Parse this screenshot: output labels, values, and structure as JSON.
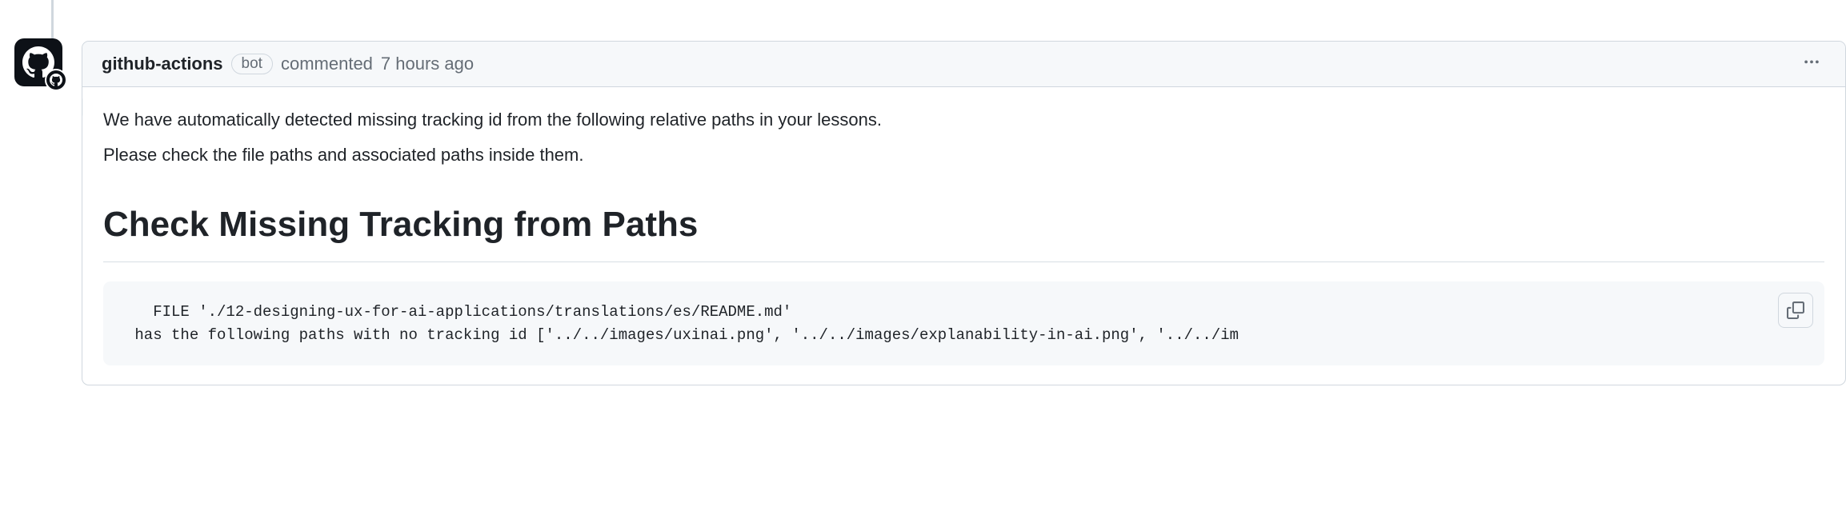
{
  "comment": {
    "author": "github-actions",
    "bot_label": "bot",
    "action_text": "commented",
    "timestamp": "7 hours ago",
    "menu_label": "More options",
    "intro_line1": "We have automatically detected missing tracking id from the following relative paths in your lessons.",
    "intro_line2": "Please check the file paths and associated paths inside them.",
    "heading": "Check Missing Tracking from Paths",
    "code": "   FILE './12-designing-ux-for-ai-applications/translations/es/README.md'\n has the following paths with no tracking id ['../../images/uxinai.png', '../../images/explanability-in-ai.png', '../../im",
    "copy_label": "Copy"
  }
}
